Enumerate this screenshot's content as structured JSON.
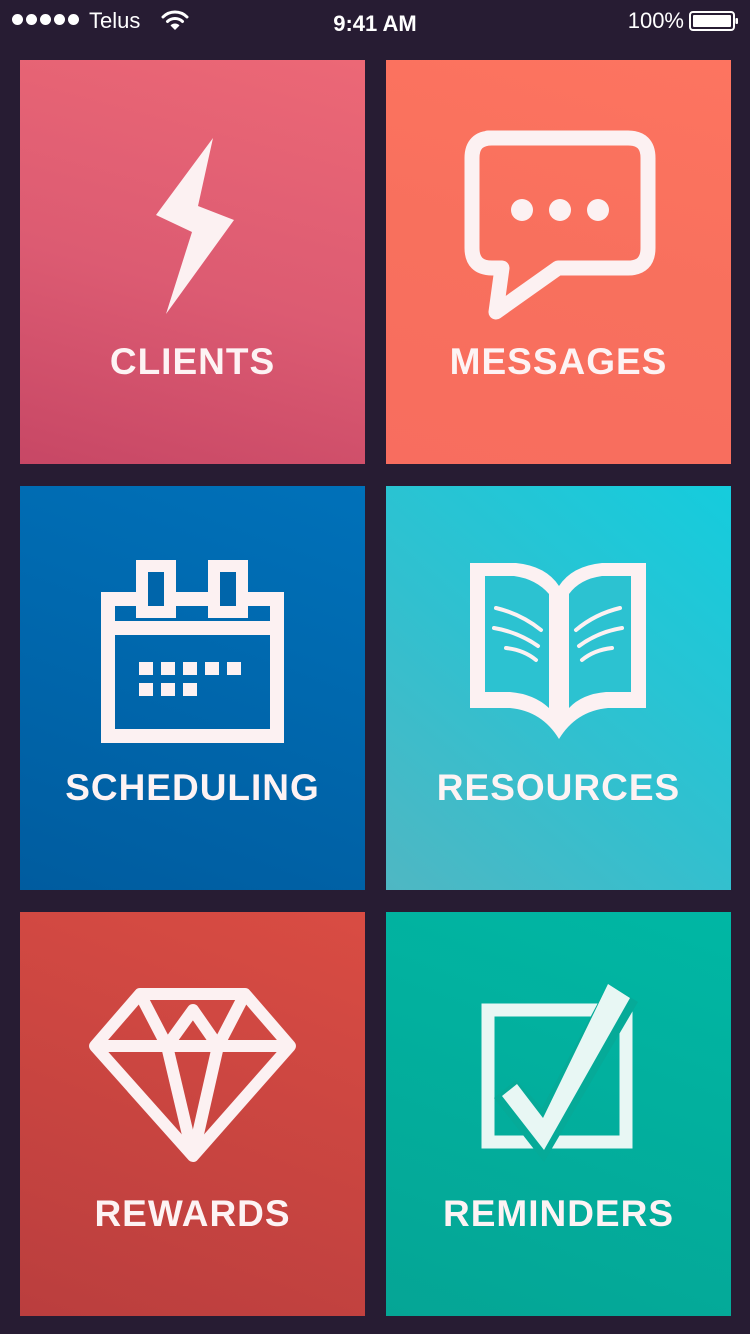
{
  "status_bar": {
    "carrier": "Telus",
    "time": "9:41 AM",
    "battery_percent": "100%",
    "signal_bars": 5,
    "battery_level": 1.0
  },
  "tiles": [
    {
      "label": "CLIENTS",
      "icon": "lightning-icon"
    },
    {
      "label": "MESSAGES",
      "icon": "chat-bubble-icon"
    },
    {
      "label": "SCHEDULING",
      "icon": "calendar-icon"
    },
    {
      "label": "RESOURCES",
      "icon": "open-book-icon"
    },
    {
      "label": "REWARDS",
      "icon": "diamond-icon"
    },
    {
      "label": "REMINDERS",
      "icon": "checkbox-icon"
    }
  ],
  "colors": {
    "background": "#271c33",
    "clients": "#dc5b72",
    "messages": "#f8705d",
    "scheduling": "#0068ad",
    "resources": "#26c4d4",
    "rewards": "#cc4541",
    "reminders": "#02ae9d",
    "icon_fill": "#fcf1f2"
  }
}
